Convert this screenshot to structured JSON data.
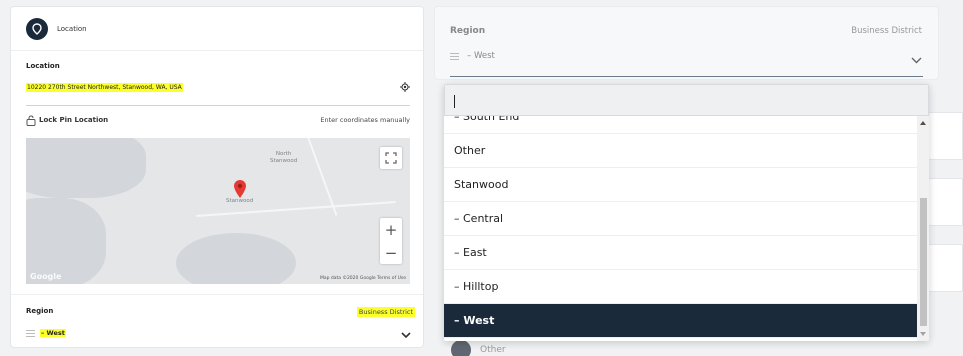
{
  "location_card": {
    "header_label": "Location",
    "location_title": "Location",
    "address": "10220 270th Street Northwest, Stanwood, WA, USA",
    "lock_pin_label": "Lock Pin Location",
    "enter_coords_label": "Enter coordinates manually",
    "map": {
      "place_north": "North\nStanwood",
      "place_town": "Stanwood",
      "zoom_in": "+",
      "zoom_out": "−",
      "google_logo": "Google",
      "attribution": "Map data ©2020 Google   Terms of Use"
    },
    "region_title": "Region",
    "business_district": "Business District",
    "region_value": "– West"
  },
  "region_panel": {
    "title": "Region",
    "business_district": "Business District",
    "value": "– West"
  },
  "dropdown": {
    "search_value": "",
    "items": [
      {
        "label": "– South End",
        "selected": false
      },
      {
        "label": "Other",
        "selected": false
      },
      {
        "label": "Stanwood",
        "selected": false
      },
      {
        "label": "– Central",
        "selected": false
      },
      {
        "label": "– East",
        "selected": false
      },
      {
        "label": "– Hilltop",
        "selected": false
      },
      {
        "label": "– West",
        "selected": true
      }
    ]
  },
  "background": {
    "other_label": "Other"
  },
  "colors": {
    "accent_navy": "#1a2a3b",
    "highlight_yellow": "#fbff2a",
    "map_pin_red": "#e53935"
  }
}
